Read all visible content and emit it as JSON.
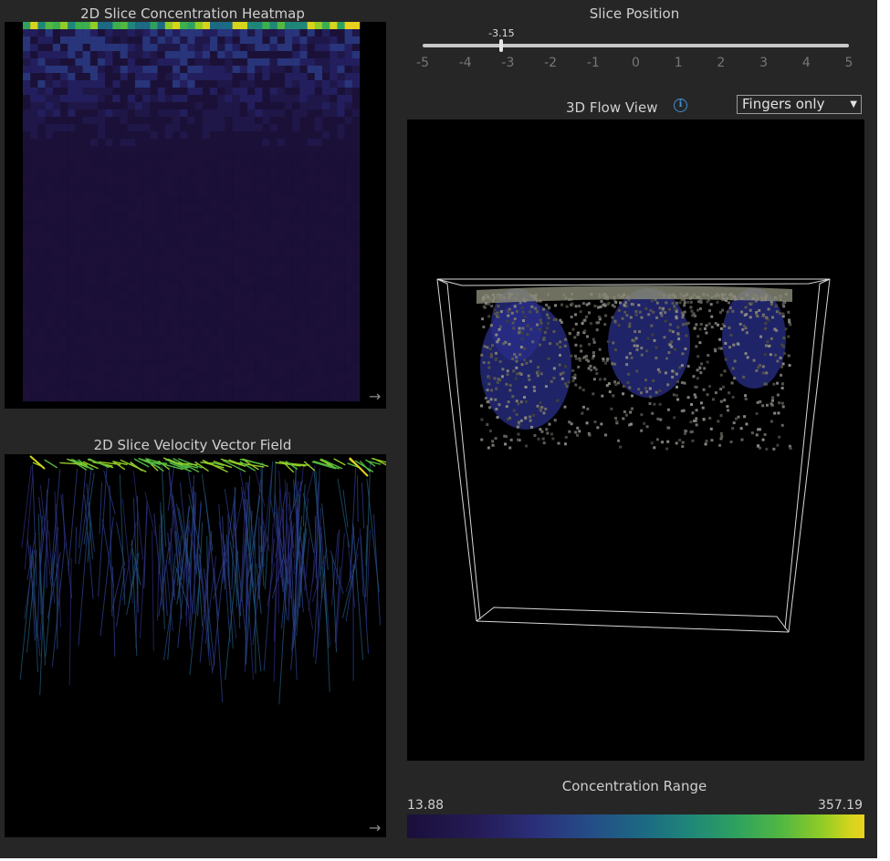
{
  "heatmap_panel": {
    "title": "2D Slice Concentration Heatmap",
    "expand_icon": "arrow-right-icon"
  },
  "velocity_panel": {
    "title": "2D Slice Velocity Vector Field",
    "expand_icon": "arrow-right-icon"
  },
  "slice_position": {
    "title": "Slice Position",
    "value_label": "-3.15",
    "value": -3.15,
    "min": -5,
    "max": 5,
    "ticks": [
      "-5",
      "-4",
      "-3",
      "-2",
      "-1",
      "0",
      "1",
      "2",
      "3",
      "4",
      "5"
    ]
  },
  "flow_view": {
    "title": "3D Flow View",
    "info_icon": "info-icon",
    "mode_selected": "Fingers only",
    "caret": "▼"
  },
  "concentration_range": {
    "title": "Concentration Range",
    "min_label": "13.88",
    "max_label": "357.19",
    "colors": [
      "#1a0f3a",
      "#2b2f7a",
      "#1c6a83",
      "#2ea15f",
      "#93cc25",
      "#e9d11e"
    ]
  }
}
